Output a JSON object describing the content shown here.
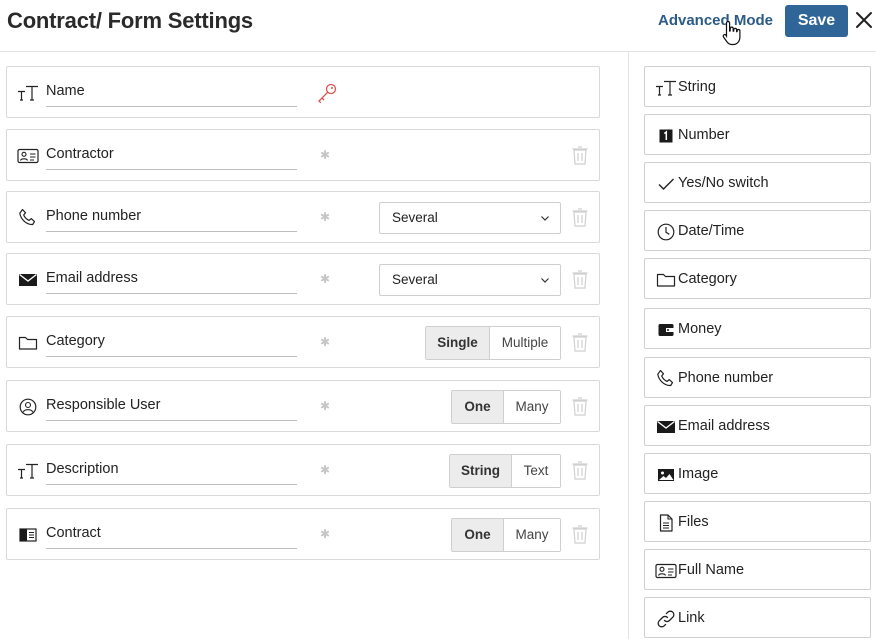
{
  "header": {
    "title": "Contract/ Form Settings",
    "advanced_mode": "Advanced Mode",
    "save_label": "Save"
  },
  "colors": {
    "accent": "#2f6597",
    "link": "#2c5b87",
    "key_icon": "#d9534f"
  },
  "fields": [
    {
      "name": "Name",
      "icon": "text-type-icon",
      "key": true
    },
    {
      "name": "Contractor",
      "icon": "id-card-icon"
    },
    {
      "name": "Phone number",
      "icon": "phone-icon",
      "select": "Several"
    },
    {
      "name": "Email address",
      "icon": "envelope-icon",
      "select": "Several"
    },
    {
      "name": "Category",
      "icon": "folder-icon",
      "options": [
        "Single",
        "Multiple"
      ]
    },
    {
      "name": "Responsible User",
      "icon": "user-circle-icon",
      "options": [
        "One",
        "Many"
      ]
    },
    {
      "name": "Description",
      "icon": "text-type-icon",
      "options": [
        "String",
        "Text"
      ]
    },
    {
      "name": "Contract",
      "icon": "book-icon",
      "options": [
        "One",
        "Many"
      ]
    }
  ],
  "types": [
    {
      "label": "String",
      "icon": "text-type-icon"
    },
    {
      "label": "Number",
      "icon": "number-icon"
    },
    {
      "label": "Yes/No switch",
      "icon": "check-icon"
    },
    {
      "label": "Date/Time",
      "icon": "clock-icon"
    },
    {
      "label": "Category",
      "icon": "folder-icon"
    },
    {
      "label": "Money",
      "icon": "wallet-icon"
    },
    {
      "label": "Phone number",
      "icon": "phone-icon"
    },
    {
      "label": "Email address",
      "icon": "envelope-icon"
    },
    {
      "label": "Image",
      "icon": "image-icon"
    },
    {
      "label": "Files",
      "icon": "file-icon"
    },
    {
      "label": "Full Name",
      "icon": "id-card-icon"
    },
    {
      "label": "Link",
      "icon": "link-icon"
    }
  ]
}
